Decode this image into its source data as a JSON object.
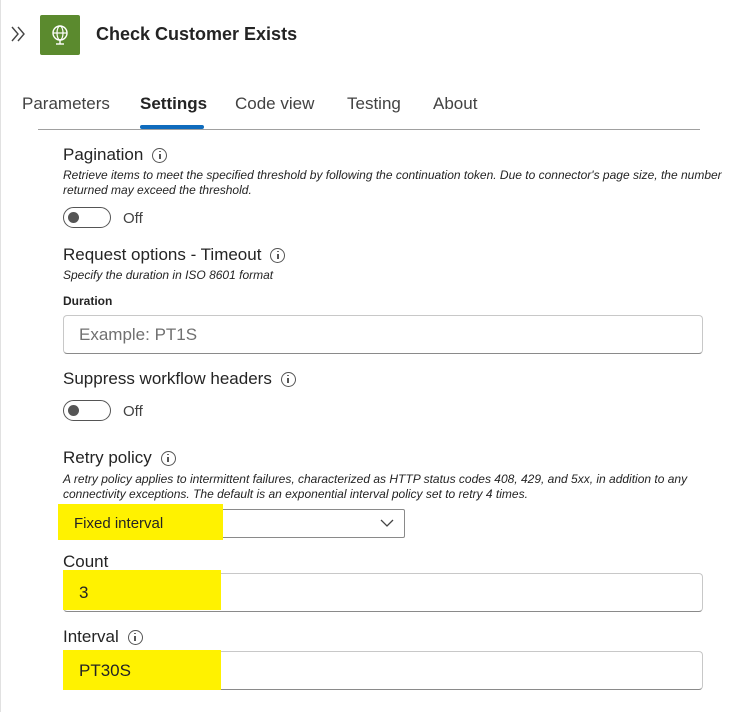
{
  "header": {
    "title": "Check Customer Exists",
    "collapse_icon": "double-chevron-right-icon",
    "app_icon": "globe-icon",
    "app_icon_color": "#5b8a2e"
  },
  "tabs": [
    {
      "label": "Parameters",
      "active": false
    },
    {
      "label": "Settings",
      "active": true
    },
    {
      "label": "Code view",
      "active": false
    },
    {
      "label": "Testing",
      "active": false
    },
    {
      "label": "About",
      "active": false
    }
  ],
  "accent_color": "#0f6cbd",
  "highlight_color": "#fff200",
  "pagination": {
    "label": "Pagination",
    "description": "Retrieve items to meet the specified threshold by following the continuation token. Due to connector's page size, the number returned may exceed the threshold.",
    "state": "Off"
  },
  "timeout": {
    "label": "Request options - Timeout",
    "description": "Specify the duration in ISO 8601 format",
    "field_label": "Duration",
    "placeholder": "Example: PT1S"
  },
  "suppress": {
    "label": "Suppress workflow headers",
    "state": "Off"
  },
  "retry": {
    "label": "Retry policy",
    "description": "A retry policy applies to intermittent failures, characterized as HTTP status codes 408, 429, and 5xx, in addition to any connectivity exceptions. The default is an exponential interval policy set to retry 4 times.",
    "selected": "Fixed interval"
  },
  "count": {
    "label": "Count",
    "value": "3"
  },
  "interval": {
    "label": "Interval",
    "value": "PT30S"
  }
}
